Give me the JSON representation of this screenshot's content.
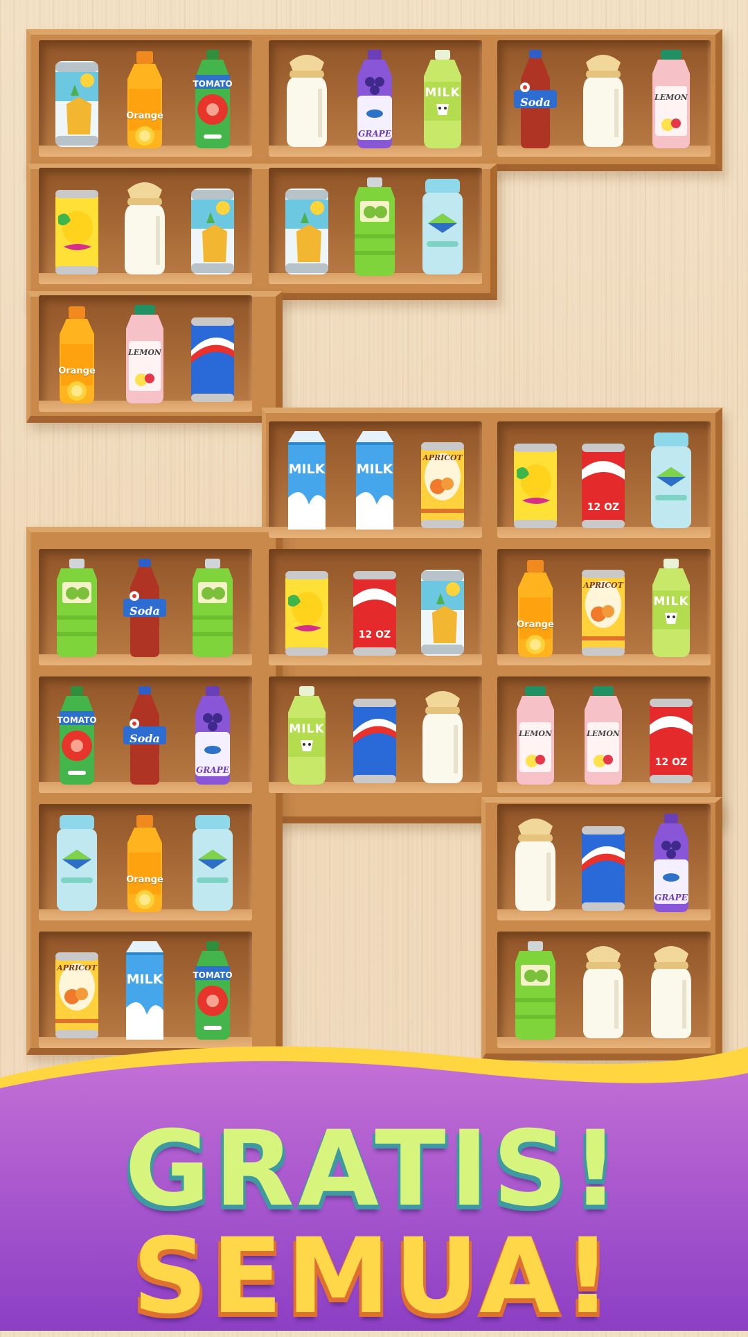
{
  "banner": {
    "line1": "GRATIS!",
    "line2": "SEMUA!",
    "colors": {
      "line1": "#d7f57c",
      "line2": "#ffd84a",
      "background_top": "#c36fd6",
      "background_bottom": "#8c3fc4",
      "wave_edge": "#ffd640"
    }
  },
  "product_types": {
    "pineapple_can": {
      "icon": "pineapple-can-icon",
      "label": ""
    },
    "orange_bottle": {
      "icon": "orange-juice-bottle-icon",
      "label": "Orange"
    },
    "tomato_bottle": {
      "icon": "tomato-juice-bottle-icon",
      "label": "TOMATO"
    },
    "milk_jar": {
      "icon": "milk-jar-icon",
      "label": ""
    },
    "grape_bottle": {
      "icon": "grape-juice-bottle-icon",
      "label": "GRAPE"
    },
    "milk_bottle": {
      "icon": "milk-bottle-icon",
      "label": "MILK"
    },
    "soda_bottle": {
      "icon": "soda-bottle-icon",
      "label": "Soda"
    },
    "lemon_jug": {
      "icon": "lemon-juice-jug-icon",
      "label": "LEMON"
    },
    "lemon_can": {
      "icon": "lemon-can-icon",
      "label": ""
    },
    "kiwi_jug": {
      "icon": "kiwi-jug-icon",
      "label": ""
    },
    "water_bottle": {
      "icon": "water-bottle-icon",
      "label": ""
    },
    "blue_can": {
      "icon": "blue-can-icon",
      "label": ""
    },
    "milk_carton": {
      "icon": "milk-carton-icon",
      "label": "MILK"
    },
    "apricot_can": {
      "icon": "apricot-can-icon",
      "label": "APRICOT"
    },
    "cola_can": {
      "icon": "red-cola-can-icon",
      "label": "12 OZ"
    }
  },
  "shelves": [
    {
      "id": "r1-c1",
      "items": [
        "pineapple_can",
        "orange_bottle",
        "tomato_bottle"
      ]
    },
    {
      "id": "r1-c2",
      "items": [
        "milk_jar",
        "grape_bottle",
        "milk_bottle"
      ]
    },
    {
      "id": "r1-c3",
      "items": [
        "soda_bottle",
        "milk_jar",
        "lemon_jug"
      ]
    },
    {
      "id": "r2-c1",
      "items": [
        "lemon_can",
        "milk_jar",
        "pineapple_can"
      ]
    },
    {
      "id": "r2-c2",
      "items": [
        "pineapple_can",
        "kiwi_jug",
        "water_bottle"
      ]
    },
    {
      "id": "r3-c1",
      "items": [
        "orange_bottle",
        "lemon_jug",
        "blue_can"
      ]
    },
    {
      "id": "r4-c2",
      "items": [
        "milk_carton",
        "milk_carton",
        "apricot_can"
      ]
    },
    {
      "id": "r4-c3",
      "items": [
        "lemon_can",
        "cola_can",
        "water_bottle"
      ]
    },
    {
      "id": "r5-c1",
      "items": [
        "kiwi_jug",
        "soda_bottle",
        "kiwi_jug"
      ]
    },
    {
      "id": "r5-c2",
      "items": [
        "lemon_can",
        "cola_can",
        "pineapple_can"
      ]
    },
    {
      "id": "r5-c3",
      "items": [
        "orange_bottle",
        "apricot_can",
        "milk_bottle"
      ]
    },
    {
      "id": "r6-c1",
      "items": [
        "tomato_bottle",
        "soda_bottle",
        "grape_bottle"
      ]
    },
    {
      "id": "r6-c2",
      "items": [
        "milk_bottle",
        "blue_can",
        "milk_jar"
      ]
    },
    {
      "id": "r6-c3",
      "items": [
        "lemon_jug",
        "lemon_jug",
        "cola_can"
      ]
    },
    {
      "id": "r7-c1",
      "items": [
        "water_bottle",
        "orange_bottle",
        "water_bottle"
      ]
    },
    {
      "id": "r7-c3",
      "items": [
        "milk_jar",
        "blue_can",
        "grape_bottle"
      ]
    },
    {
      "id": "r8-c1",
      "items": [
        "apricot_can",
        "milk_carton",
        "tomato_bottle"
      ]
    },
    {
      "id": "r8-c3",
      "items": [
        "kiwi_jug",
        "milk_jar",
        "milk_jar"
      ]
    }
  ]
}
